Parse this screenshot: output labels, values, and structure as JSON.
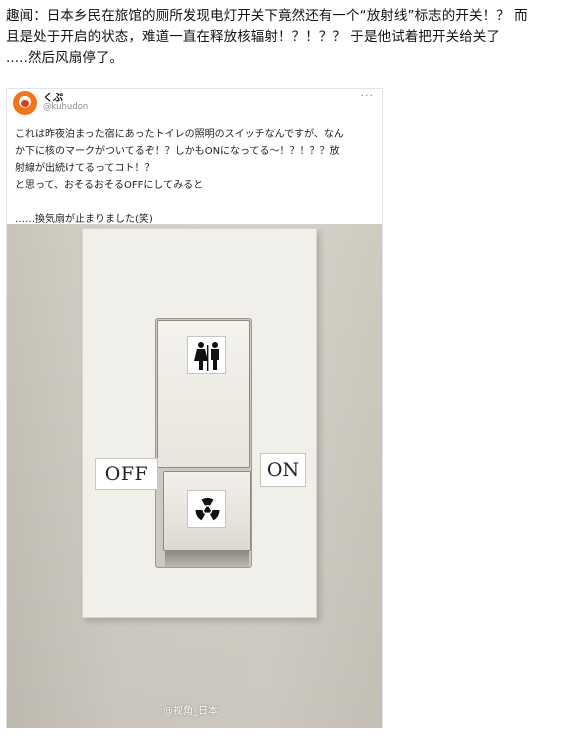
{
  "post": {
    "lines": [
      "趣闻：日本乡民在旅馆的厕所发现电灯开关下竟然还有一个“放射线”标志的开关！？ 而",
      "且是处于开启的状态，难道一直在释放核辐射！？！？？ 于是他试着把开关给关了",
      ".....然后风扇停了。"
    ]
  },
  "tweet": {
    "display_name": "くぷ",
    "handle": "@kuhudon",
    "more": "···",
    "body_lines": [
      "これは昨夜泊まった宿にあったトイレの照明のスイッチなんですが、なん",
      "か下に核のマークがついてるぞ！？しかもONになってる〜！？！？？放",
      "射線が出続けてるってコト！？",
      "と思って、おそるおそるOFFにしてみると",
      "",
      "……換気扇が止まりました(笑)"
    ]
  },
  "photo": {
    "label_off": "OFF",
    "label_on": "ON",
    "top_sticker_icon": "restroom-icon",
    "bottom_sticker_icon": "radiation-icon",
    "watermark": "@视角_日本"
  },
  "colors": {
    "wall": "#d6d2c9",
    "plate": "#f1efea",
    "avatar": "#f4731f",
    "handle": "#8a8f95"
  }
}
